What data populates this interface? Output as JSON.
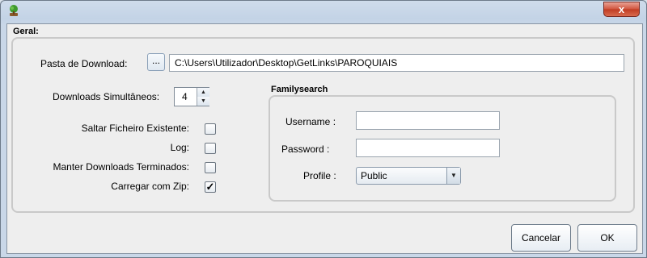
{
  "window": {
    "close_symbol": "x",
    "icon": "tree-icon"
  },
  "geral": {
    "title": "Geral:",
    "pasta_label": "Pasta de Download:",
    "browse_label": "...",
    "path_value": "C:\\Users\\Utilizador\\Desktop\\GetLinks\\PAROQUIAIS",
    "downloads_label": "Downloads Simultâneos:",
    "downloads_value": "4",
    "spin_up": "▲",
    "spin_down": "▼",
    "options": [
      {
        "label": "Saltar Ficheiro Existente:",
        "checked": false,
        "mark": ""
      },
      {
        "label": "Log:",
        "checked": false,
        "mark": ""
      },
      {
        "label": "Manter Downloads Terminados:",
        "checked": false,
        "mark": ""
      },
      {
        "label": "Carregar com Zip:",
        "checked": true,
        "mark": "✓"
      }
    ]
  },
  "familysearch": {
    "title": "Familysearch",
    "username_label": "Username :",
    "username_value": "",
    "password_label": "Password  :",
    "password_value": "",
    "profile_label": "Profile :",
    "profile_value": "Public",
    "profile_arrow": "▼"
  },
  "buttons": {
    "cancel": "Cancelar",
    "ok": "OK"
  }
}
